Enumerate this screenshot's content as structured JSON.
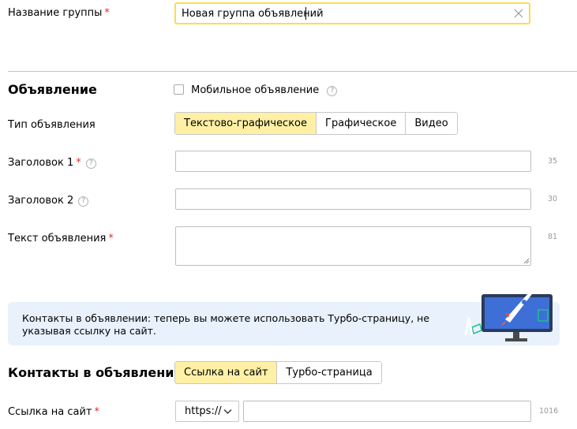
{
  "group": {
    "label": "Название группы",
    "value": "Новая группа объявлений"
  },
  "ad": {
    "section_title": "Объявление",
    "mobile_label": "Мобильное объявление",
    "type_label": "Тип объявления",
    "types": [
      "Текстово-графическое",
      "Графическое",
      "Видео"
    ],
    "headline1_label": "Заголовок 1",
    "headline1_counter": "35",
    "headline2_label": "Заголовок 2",
    "headline2_counter": "30",
    "text_label": "Текст объявления",
    "text_counter": "81"
  },
  "banner": {
    "text": "Контакты в объявлении: теперь вы можете использовать Турбо-страницу, не указывая ссылку на сайт."
  },
  "contacts": {
    "section_title": "Контакты в объявлении",
    "options": [
      "Ссылка на сайт",
      "Турбо-страница"
    ],
    "link_label": "Ссылка на сайт",
    "protocol": "https://",
    "link_counter": "1016"
  },
  "required_mark": "*",
  "help_mark": "?",
  "colors": {
    "active_segment": "#fff0a5",
    "focus_border": "#ffdb4d",
    "required": "#e52b2b",
    "banner_bg": "#e8f1fc"
  }
}
